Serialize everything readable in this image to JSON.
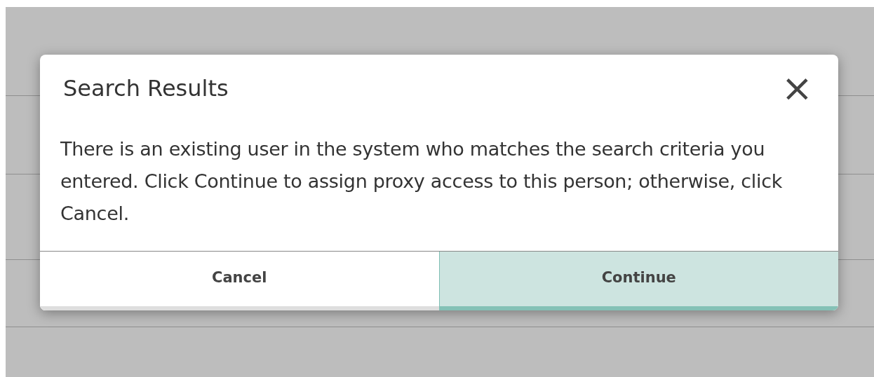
{
  "dialog": {
    "title": "Search Results",
    "close": "×",
    "message": "There is an existing user in the system who matches the search criteria you entered. Click Continue to assign proxy access to this person; otherwise, click Cancel.",
    "buttons": [
      {
        "label": "Cancel",
        "kind": "secondary"
      },
      {
        "label": "Continue",
        "kind": "primary"
      }
    ]
  }
}
